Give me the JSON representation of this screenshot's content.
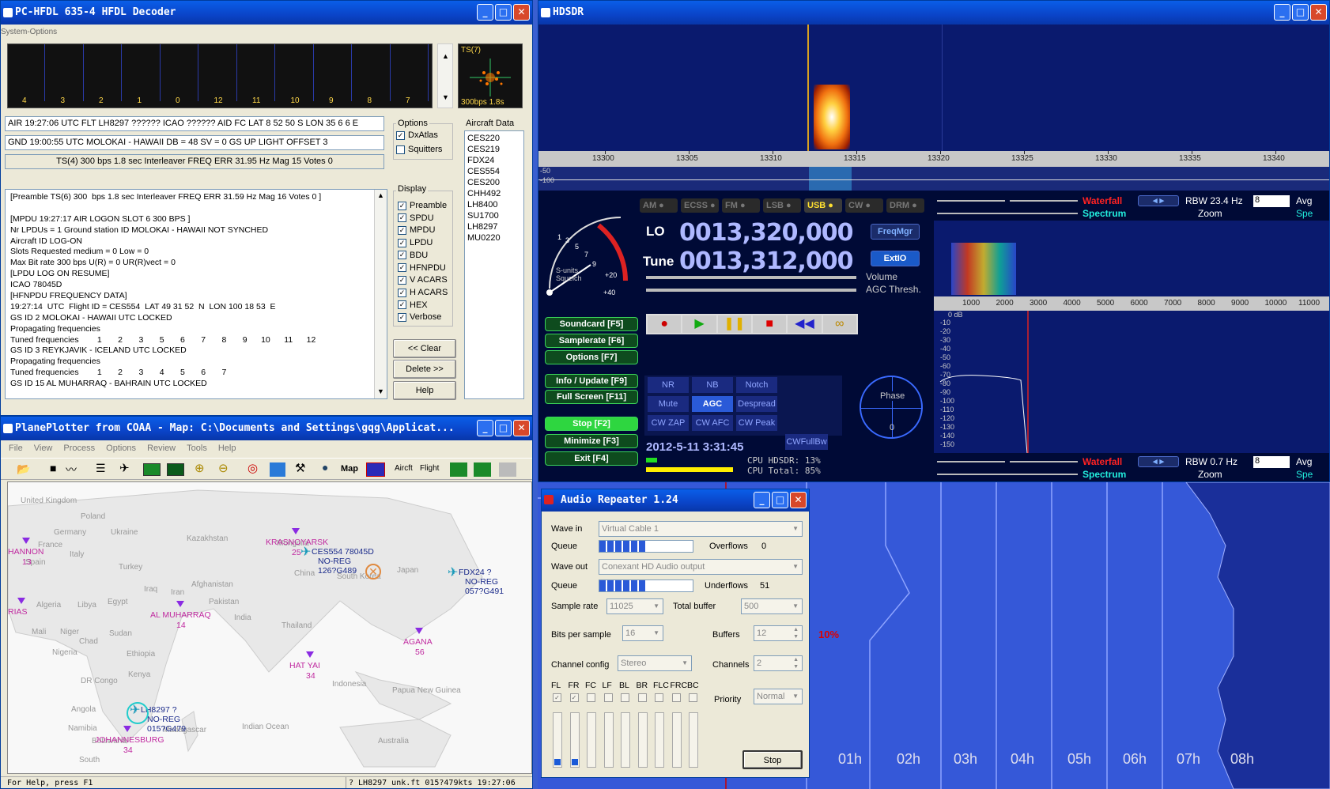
{
  "hfdl": {
    "title": "PC-HFDL 635-4 HFDL Decoder",
    "menu": "System-Options",
    "slot_numbers": [
      "4",
      "3",
      "2",
      "1",
      "0",
      "12",
      "11",
      "10",
      "9",
      "8",
      "7"
    ],
    "ts_label": "TS(7)",
    "ts_rate": "300bps 1.8s",
    "air_line": "AIR 19:27:06  UTC FLT LH8297 ?????? ICAO ?????? AID FC LAT 8 52 50  S  LON 35 6 6  E",
    "gnd_line": "GND 19:00:55 UTC MOLOKAI - HAWAII  DB = 48  SV = 0  GS UP LIGHT  OFFSET 3",
    "ts_line": "TS(4) 300  bps 1.8 sec Interleaver FREQ ERR 31.95 Hz Mag 15 Votes 0",
    "options_label": "Options",
    "dxatlas": "DxAtlas",
    "squitters": "Squitters",
    "aircraft_label": "Aircraft Data",
    "aircraft": [
      "CES220",
      "CES219",
      "FDX24",
      "CES554",
      "CES200",
      "CHH492",
      "LH8400",
      "SU1700",
      "LH8297",
      "MU0220"
    ],
    "display_label": "Display",
    "display_opts": [
      "Preamble",
      "SPDU",
      "MPDU",
      "LPDU",
      "BDU",
      "HFNPDU",
      "V ACARS",
      "H ACARS",
      "HEX",
      "Verbose"
    ],
    "log": [
      "[Preamble TS(6) 300  bps 1.8 sec Interleaver FREQ ERR 31.59 Hz Mag 16 Votes 0 ]",
      "",
      "[MPDU 19:27:17 AIR LOGON SLOT 6 300 BPS ]",
      "Nr LPDUs = 1 Ground station ID MOLOKAI - HAWAII NOT SYNCHED",
      "Aircraft ID LOG-ON",
      "Slots Requested medium = 0 Low = 0",
      "Max Bit rate 300 bps U(R) = 0 UR(R)vect = 0",
      "[LPDU LOG ON RESUME]",
      "ICAO 78045D",
      "[HFNPDU FREQUENCY DATA]",
      "19:27:14  UTC  Flight ID = CES554  LAT 49 31 52  N  LON 100 18 53  E",
      "GS ID 2 MOLOKAI - HAWAII UTC LOCKED",
      "Propagating frequencies",
      "Tuned frequencies        1       2       3       5       6       7       8       9      10      11      12",
      "GS ID 3 REYKJAVIK - ICELAND UTC LOCKED",
      "Propagating frequencies",
      "Tuned frequencies        1       2       3       4       5       6       7",
      "GS ID 15 AL MUHARRAQ - BAHRAIN UTC LOCKED"
    ],
    "clear": "<< Clear",
    "delete": "Delete >>",
    "help": "Help"
  },
  "plane": {
    "title": "PlanePlotter from COAA - Map: C:\\Documents and Settings\\gqg\\Applicat...",
    "menu": [
      "File",
      "View",
      "Process",
      "Options",
      "Review",
      "Tools",
      "Help"
    ],
    "tb_text": [
      "Map",
      "Aircft",
      "Flight"
    ],
    "status_left": "For Help, press F1",
    "status_right": "? LH8297 unk.ft 015?479kts 19:27:06",
    "geo": [
      "United Kingdom",
      "Poland",
      "Germany",
      "Ukraine",
      "France",
      "Spain",
      "Italy",
      "Kazakhstan",
      "Turkey",
      "Mongolia",
      "Iraq",
      "Iran",
      "Afghanistan",
      "Algeria",
      "Libya",
      "Egypt",
      "Pakistan",
      "China",
      "Japan",
      "South Korea",
      "India",
      "Mali",
      "Niger",
      "Chad",
      "Sudan",
      "Nigeria",
      "Ethiopia",
      "Thailand",
      "Kenya",
      "DR Congo",
      "Angola",
      "Namibia",
      "Botswana",
      "Madagascar",
      "Indonesia",
      "Papua New Guinea",
      "Australia",
      "Indian Ocean",
      "South"
    ],
    "stations": [
      {
        "name": "HANNON",
        "num": "13"
      },
      {
        "name": "KRASNOYARSK",
        "num": "25"
      },
      {
        "name": "AL MUHARRAQ",
        "num": "14"
      },
      {
        "name": "AGANA",
        "num": "56"
      },
      {
        "name": "HAT YAI",
        "num": "34"
      },
      {
        "name": "JOHANNESBURG",
        "num": "34"
      },
      {
        "name": "RIAS",
        "num": ""
      }
    ],
    "aircraft": [
      {
        "l1": "CES554 78045D",
        "l2": "NO-REG",
        "l3": "126?G489"
      },
      {
        "l1": "FDX24 ?",
        "l2": "NO-REG",
        "l3": "057?G491"
      },
      {
        "l1": "LH8297 ?",
        "l2": "NO-REG",
        "l3": "015?G479"
      }
    ]
  },
  "hdsdr": {
    "title": "HDSDR",
    "freq_ticks": [
      "13300",
      "13305",
      "13310",
      "13315",
      "13320",
      "13325",
      "13330",
      "13335",
      "13340"
    ],
    "db_ticks": [
      "-50",
      "-100"
    ],
    "modes": [
      "AM",
      "ECSS",
      "FM",
      "LSB",
      "USB",
      "CW",
      "DRM"
    ],
    "lo_label": "LO",
    "lo_value": "0013,320,000",
    "tune_label": "Tune",
    "tune_value": "0013,312,000",
    "freqmgr": "FreqMgr",
    "extio": "ExtIO",
    "volume": "Volume",
    "agc": "AGC Thresh.",
    "smeter": [
      "1",
      "3",
      "5",
      "7",
      "9",
      "+20",
      "+40"
    ],
    "smeter_label": "S-units\nSquelch",
    "left_buttons": [
      "Soundcard [F5]",
      "Samplerate [F6]",
      "Options  [F7]",
      "Info / Update  [F9]",
      "Full Screen  [F11]",
      "Stop   [F2]",
      "Minimize  [F3]",
      "Exit    [F4]"
    ],
    "dsp": [
      "NR",
      "NB",
      "Notch",
      "Mute",
      "AGC Slow",
      "Despread",
      "CW ZAP",
      "CW AFC",
      "CW Peak",
      "CWFullBw"
    ],
    "datetime": "2012-5-11  3:31:45",
    "cpu1": "CPU HDSDR: 13%",
    "cpu2": "CPU Total: 85%",
    "phase": "Phase",
    "phase_val": "0",
    "wf_label": "Waterfall",
    "sp_label": "Spectrum",
    "zoom": "Zoom",
    "rbw1": "RBW 23.4 Hz",
    "rbw2": "RBW  0.7 Hz",
    "avg": "Avg",
    "spe": "Spe",
    "avgval": "8",
    "audio_ticks": [
      "1000",
      "2000",
      "3000",
      "4000",
      "5000",
      "6000",
      "7000",
      "8000",
      "9000",
      "10000",
      "11000"
    ],
    "audio_db": [
      "-10",
      "-20",
      "-30",
      "-40",
      "-50",
      "-60",
      "-70",
      "-80",
      "-90",
      "-100",
      "-110",
      "-120",
      "-130",
      "-140",
      "-150"
    ],
    "db_top": "0 dB"
  },
  "repeater": {
    "title": "Audio Repeater 1.24",
    "wave_in": "Wave in",
    "wave_in_val": "Virtual Cable 1",
    "queue": "Queue",
    "overflows": "Overflows",
    "overflows_val": "0",
    "wave_out": "Wave out",
    "wave_out_val": "Conexant HD Audio output",
    "underflows": "Underflows",
    "underflows_val": "51",
    "sample_rate": "Sample rate",
    "sample_rate_val": "11025",
    "total_buffer": "Total buffer",
    "total_buffer_val": "500",
    "bits": "Bits per sample",
    "bits_val": "16",
    "buffers": "Buffers",
    "buffers_val": "12",
    "chconf": "Channel config",
    "chconf_val": "Stereo",
    "channels": "Channels",
    "channels_val": "2",
    "chans": [
      "FL",
      "FR",
      "FC",
      "LF",
      "BL",
      "BR",
      "FLC",
      "FRC",
      "BC"
    ],
    "priority": "Priority",
    "priority_val": "Normal",
    "stop": "Stop"
  },
  "timeline": {
    "hours": [
      "01h",
      "02h",
      "03h",
      "04h",
      "05h",
      "06h",
      "07h",
      "08h"
    ],
    "pct": "10%"
  }
}
